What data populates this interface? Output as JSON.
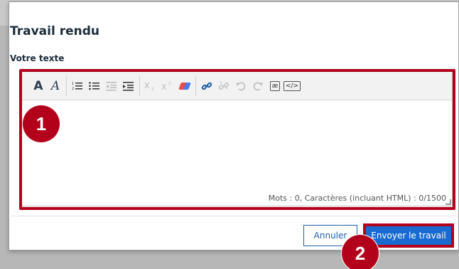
{
  "dialog": {
    "title": "Travail rendu",
    "field_label": "Votre texte",
    "word_count": "Mots : 0, Caractères (incluant HTML) : 0/1500",
    "cancel_label": "Annuler",
    "submit_label": "Envoyer le travail"
  },
  "toolbar": {
    "groups": [
      [
        "font-size-icon",
        "font-style-icon"
      ],
      [
        "ordered-list-icon",
        "unordered-list-icon",
        "outdent-icon",
        "indent-icon"
      ],
      [
        "subscript-icon",
        "superscript-icon",
        "clear-format-icon"
      ],
      [
        "link-icon",
        "unlink-icon",
        "undo-icon",
        "redo-icon",
        "special-char-icon",
        "html-source-icon"
      ]
    ]
  },
  "callouts": {
    "one": "1",
    "two": "2"
  },
  "colors": {
    "accent": "#1a6bd1",
    "callout": "#b3001b"
  }
}
